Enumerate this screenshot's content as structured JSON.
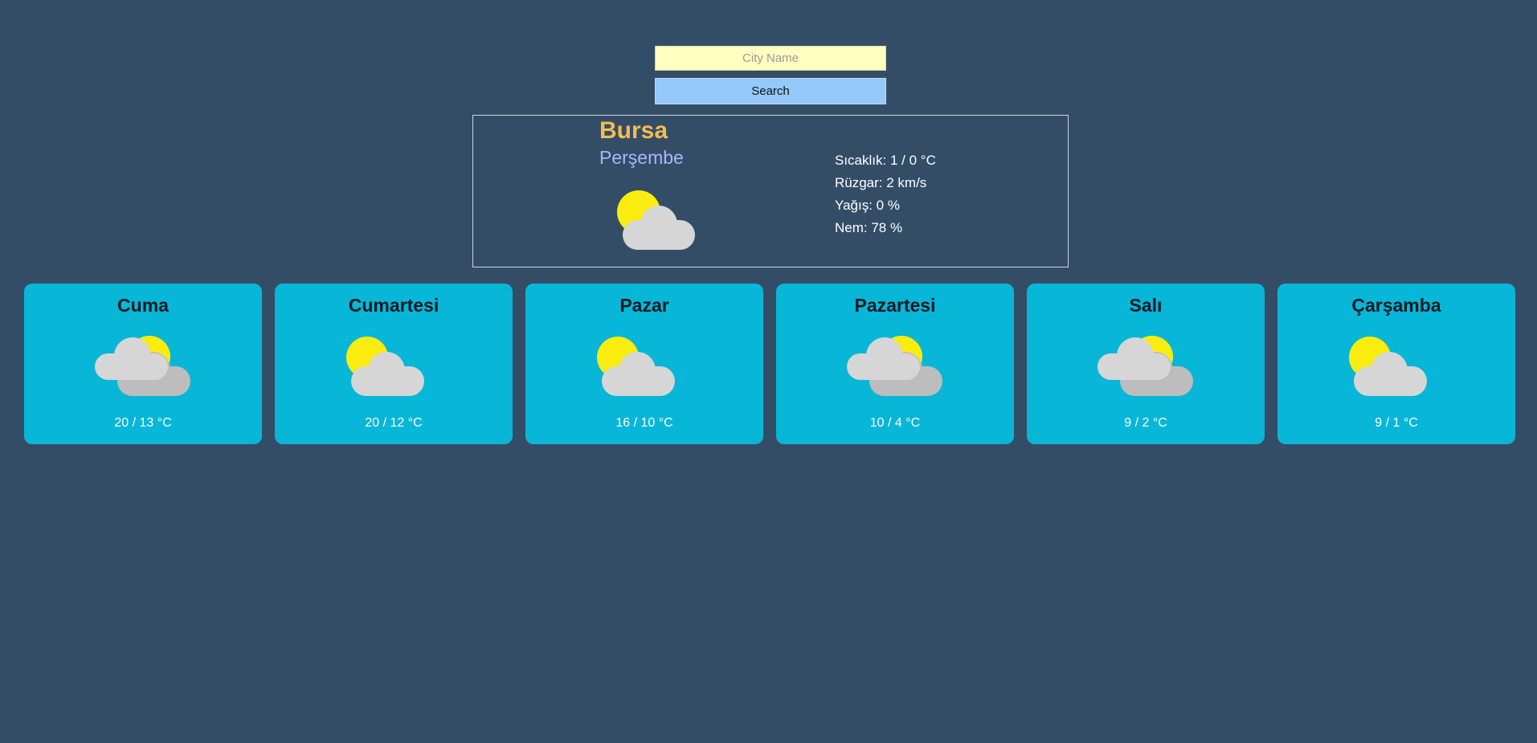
{
  "search": {
    "placeholder": "City Name",
    "button_label": "Search"
  },
  "current": {
    "city": "Bursa",
    "day": "Perşembe",
    "icon": "sun-behind-cloud-icon",
    "details": {
      "temperature": "Sıcaklık: 1 / 0 °C",
      "wind": "Rüzgar: 2 km/s",
      "precipitation": "Yağış: 0 %",
      "humidity": "Nem: 78 %"
    }
  },
  "forecast": [
    {
      "day": "Cuma",
      "temps": "20 / 13 °C",
      "icon": "partly-cloudy-icon"
    },
    {
      "day": "Cumartesi",
      "temps": "20 / 12 °C",
      "icon": "sun-behind-cloud-icon"
    },
    {
      "day": "Pazar",
      "temps": "16 / 10 °C",
      "icon": "sun-behind-cloud-icon"
    },
    {
      "day": "Pazartesi",
      "temps": "10 / 4 °C",
      "icon": "partly-cloudy-icon"
    },
    {
      "day": "Salı",
      "temps": "9 / 2 °C",
      "icon": "partly-cloudy-icon"
    },
    {
      "day": "Çarşamba",
      "temps": "9 / 1 °C",
      "icon": "sun-behind-cloud-icon"
    }
  ],
  "colors": {
    "background": "#344d67",
    "card": "#08b6d7",
    "sun": "#fbec0f",
    "cloud_front": "#d6d6d6",
    "cloud_back": "#bdbdbd",
    "city": "#f2bd52",
    "day": "#a9b6ff"
  }
}
